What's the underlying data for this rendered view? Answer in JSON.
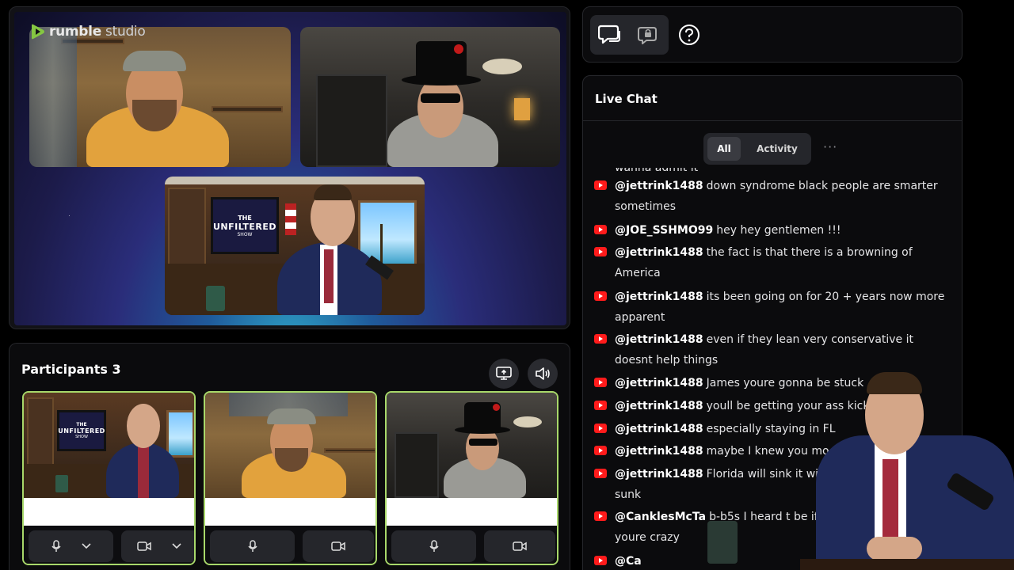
{
  "brand": {
    "name_bold": "rumble",
    "name_light": " studio",
    "accent": "#85c742"
  },
  "stage": {
    "tv": {
      "line1": "THE",
      "line2": "UNFILTERED",
      "line3": "SHOW"
    }
  },
  "participants": {
    "title": "Participants",
    "count": "3",
    "cards": [
      {
        "tv_line1": "THE",
        "tv_line2": "UNFILTERED",
        "tv_line3": "SHOW"
      },
      {},
      {}
    ]
  },
  "toolbar": {
    "tools": [
      "chat-bubble-icon",
      "lock-chat-icon",
      "help-icon"
    ]
  },
  "chat": {
    "title": "Live Chat",
    "tabs": {
      "all": "All",
      "activity": "Activity"
    },
    "more": "···",
    "partial_top": "wanna admit it",
    "messages": [
      {
        "user": "@jettrink1488",
        "text": "down syndrome black people are smarter sometimes"
      },
      {
        "user": "@JOE_SSHMO99",
        "text": "hey hey gentlemen !!!"
      },
      {
        "user": "@jettrink1488",
        "text": "the fact is that there is a browning of America"
      },
      {
        "user": "@jettrink1488",
        "text": "its been going on for 20 + years now more apparent"
      },
      {
        "user": "@jettrink1488",
        "text": "even if they lean very conservative it doesnt help things"
      },
      {
        "user": "@jettrink1488",
        "text": "James youre gonna be stuck"
      },
      {
        "user": "@jettrink1488",
        "text": "youll be getting your ass kick"
      },
      {
        "user": "@jettrink1488",
        "text": "especially staying in FL"
      },
      {
        "user": "@jettrink1488",
        "text": "maybe I knew you mo"
      },
      {
        "user": "@jettrink1488",
        "text": "Florida will sink it will sunk"
      },
      {
        "user": "@CanklesMcTa",
        "text": "b-b5s I heard t be if youre crazy"
      },
      {
        "user": "@Ca",
        "text": ""
      }
    ]
  }
}
